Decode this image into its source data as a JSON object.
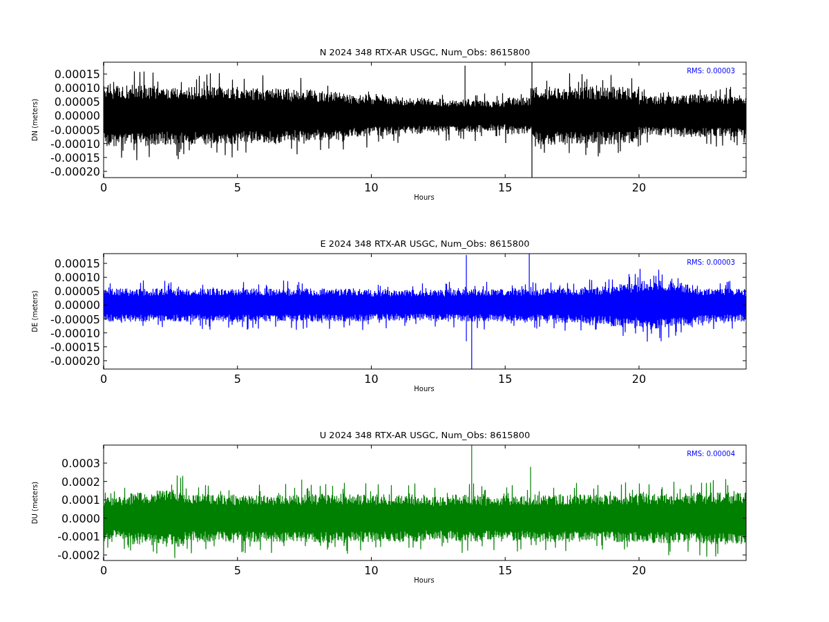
{
  "panels": [
    {
      "title": "N 2024 348 RTX-AR  USGC, Num_Obs: 8615800",
      "ylabel": "DN (meters)",
      "xlabel": "Hours",
      "rms": "RMS:  0.00003",
      "color": "#000000",
      "xticks": [
        "0",
        "5",
        "10",
        "15",
        "20"
      ],
      "yticks": [
        "0.00015",
        "0.00010",
        "0.00005",
        "0.00000",
        "-0.00005",
        "-0.00010",
        "-0.00015",
        "-0.00020"
      ]
    },
    {
      "title": "E 2024 348 RTX-AR  USGC, Num_Obs: 8615800",
      "ylabel": "DE (meters)",
      "xlabel": "Hours",
      "rms": "RMS:  0.00003",
      "color": "#0000ff",
      "xticks": [
        "0",
        "5",
        "10",
        "15",
        "20"
      ],
      "yticks": [
        "0.00015",
        "0.00010",
        "0.00005",
        "0.00000",
        "-0.00005",
        "-0.00010",
        "-0.00015",
        "-0.00020"
      ]
    },
    {
      "title": "U 2024 348 RTX-AR  USGC, Num_Obs: 8615800",
      "ylabel": "DU (meters)",
      "xlabel": "Hours",
      "rms": "RMS:  0.00004",
      "color": "#008000",
      "xticks": [
        "0",
        "5",
        "10",
        "15",
        "20"
      ],
      "yticks": [
        "0.0003",
        "0.0002",
        "0.0001",
        "0.0000",
        "-0.0001",
        "-0.0002"
      ]
    }
  ]
}
